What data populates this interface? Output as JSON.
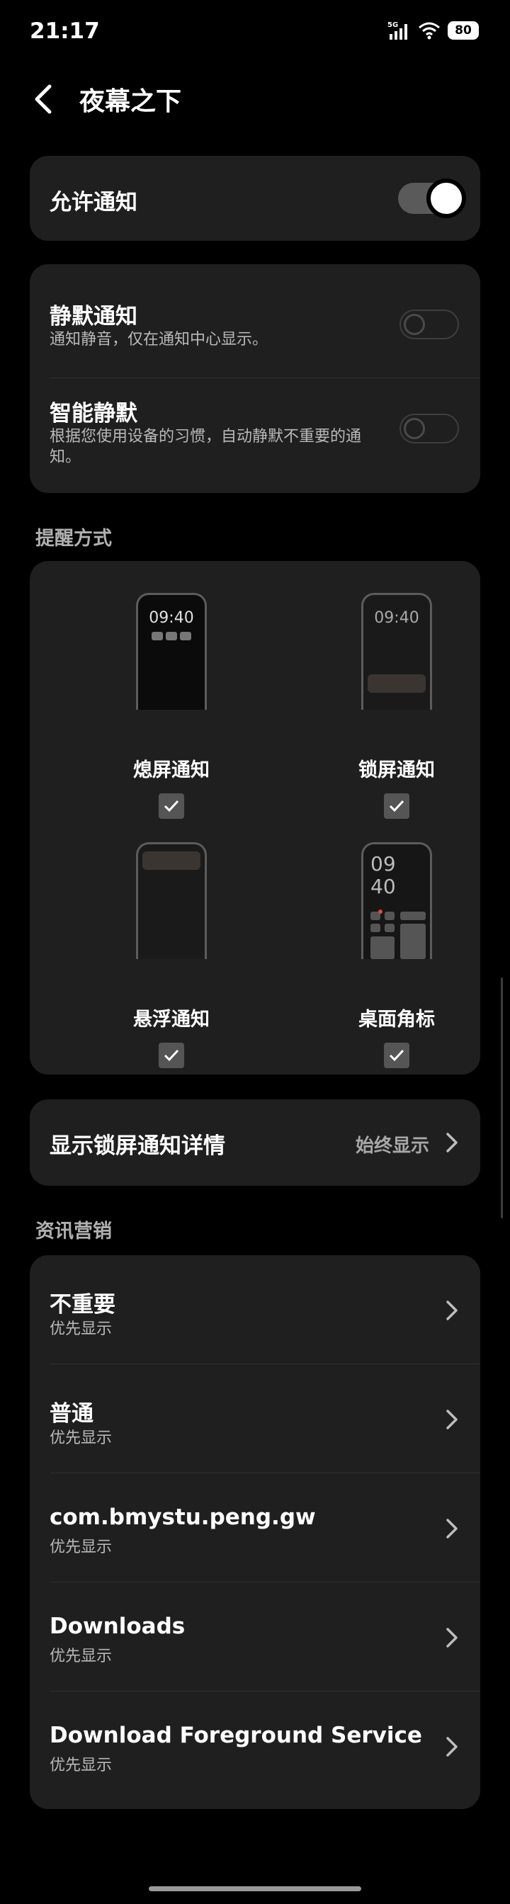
{
  "status": {
    "time": "21:17",
    "net": "5G",
    "battery": "80"
  },
  "header": {
    "title": "夜幕之下"
  },
  "allow": {
    "label": "允许通知"
  },
  "silent": {
    "title": "静默通知",
    "desc": "通知静音，仅在通知中心显示。"
  },
  "smart": {
    "title": "智能静默",
    "desc_line1": "根据您使用设备的习惯，自动静默不重要的通",
    "desc_line2": "知。"
  },
  "styles": {
    "section": "提醒方式",
    "items": [
      {
        "label": "熄屏通知",
        "checked": true,
        "preview_time": "09:40"
      },
      {
        "label": "锁屏通知",
        "checked": true,
        "preview_time": "09:40"
      },
      {
        "label": "悬浮通知",
        "checked": true
      },
      {
        "label": "桌面角标",
        "checked": true,
        "preview_hour": "09",
        "preview_min": "40"
      }
    ]
  },
  "lock_detail": {
    "label": "显示锁屏通知详情",
    "value": "始终显示"
  },
  "marketing": {
    "section": "资讯营销",
    "channels": [
      {
        "title": "不重要",
        "sub": "优先显示"
      },
      {
        "title": "普通",
        "sub": "优先显示"
      },
      {
        "title": "com.bmystu.peng.gw",
        "sub": "优先显示"
      },
      {
        "title": "Downloads",
        "sub": "优先显示"
      },
      {
        "title": "Download Foreground Service",
        "sub": "优先显示"
      }
    ]
  }
}
